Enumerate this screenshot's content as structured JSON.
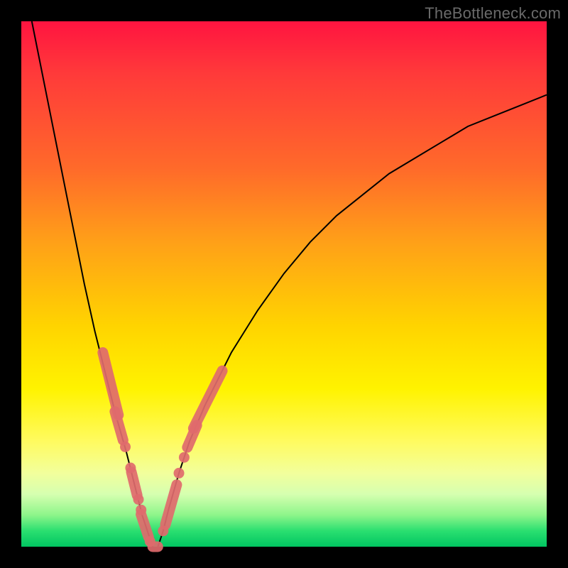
{
  "watermark": "TheBottleneck.com",
  "colors": {
    "marker": "#e06a6d",
    "curve": "#000000",
    "frame_bg_top": "#ff1440",
    "frame_bg_bottom": "#01c561",
    "page_bg": "#000000"
  },
  "chart_data": {
    "type": "line",
    "title": "",
    "xlabel": "",
    "ylabel": "",
    "xlim": [
      0,
      100
    ],
    "ylim": [
      0,
      100
    ],
    "grid": false,
    "series": [
      {
        "name": "left-branch",
        "x": [
          2,
          4,
          6,
          8,
          10,
          12,
          14,
          16,
          18,
          20,
          22,
          23,
          24,
          25
        ],
        "y": [
          100,
          90,
          80,
          70,
          60,
          50,
          41,
          33,
          25,
          18,
          10,
          6,
          3,
          0
        ]
      },
      {
        "name": "right-branch",
        "x": [
          26,
          27,
          28,
          30,
          32,
          35,
          40,
          45,
          50,
          55,
          60,
          65,
          70,
          75,
          80,
          85,
          90,
          95,
          100
        ],
        "y": [
          0,
          3,
          7,
          14,
          20,
          27,
          37,
          45,
          52,
          58,
          63,
          67,
          71,
          74,
          77,
          80,
          82,
          84,
          86
        ]
      }
    ],
    "markers": [
      {
        "x": 17.0,
        "y": 31,
        "shape": "pill",
        "len": 6.5,
        "branch": "left"
      },
      {
        "x": 18.6,
        "y": 23,
        "shape": "pill",
        "len": 3.5,
        "branch": "left"
      },
      {
        "x": 19.8,
        "y": 19,
        "shape": "dot",
        "branch": "left"
      },
      {
        "x": 20.8,
        "y": 15,
        "shape": "dot",
        "branch": "left"
      },
      {
        "x": 21.5,
        "y": 12,
        "shape": "pill",
        "len": 3.0,
        "branch": "left"
      },
      {
        "x": 22.3,
        "y": 9,
        "shape": "dot",
        "branch": "left"
      },
      {
        "x": 22.8,
        "y": 7,
        "shape": "dot",
        "branch": "left"
      },
      {
        "x": 23.5,
        "y": 4,
        "shape": "pill",
        "len": 3.0,
        "branch": "left"
      },
      {
        "x": 24.5,
        "y": 1,
        "shape": "dot",
        "branch": "left"
      },
      {
        "x": 25.5,
        "y": 0,
        "shape": "flat",
        "len": 3.0
      },
      {
        "x": 27.0,
        "y": 3,
        "shape": "dot",
        "branch": "right"
      },
      {
        "x": 28.5,
        "y": 8,
        "shape": "pill",
        "len": 4.5,
        "branch": "right"
      },
      {
        "x": 30.0,
        "y": 14,
        "shape": "dot",
        "branch": "right"
      },
      {
        "x": 31.0,
        "y": 17,
        "shape": "dot",
        "branch": "right"
      },
      {
        "x": 32.5,
        "y": 21,
        "shape": "pill",
        "len": 3.0,
        "branch": "right"
      },
      {
        "x": 35.5,
        "y": 28,
        "shape": "pill",
        "len": 6.5,
        "branch": "right"
      }
    ]
  }
}
